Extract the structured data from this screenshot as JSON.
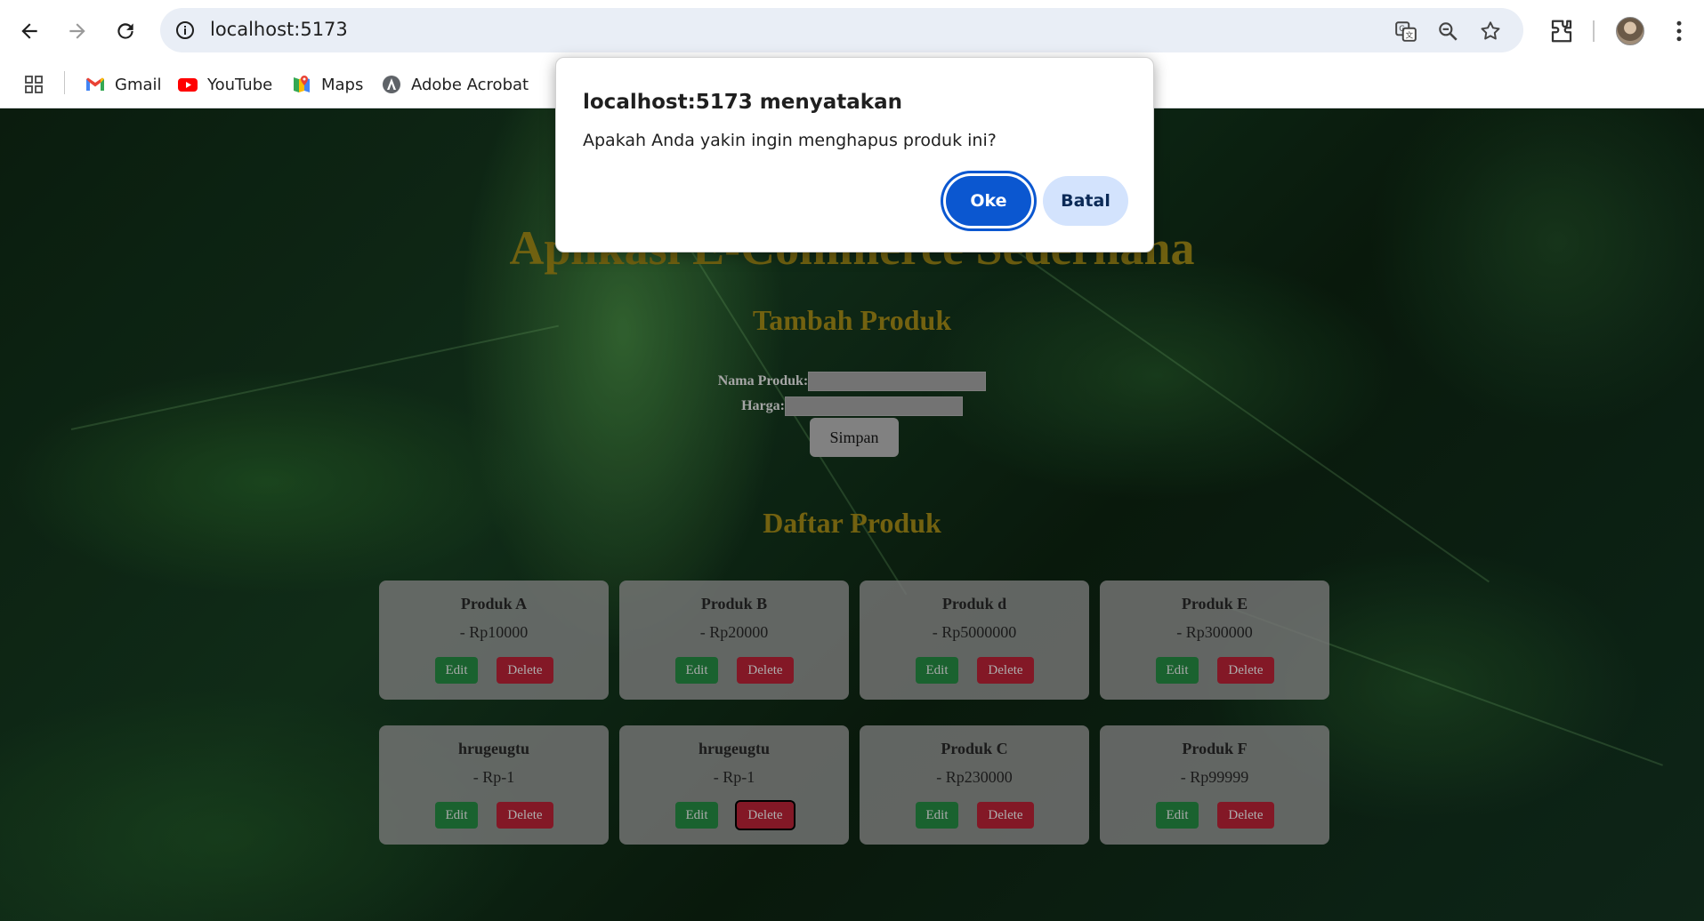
{
  "browser": {
    "url": "localhost:5173",
    "bookmarks": [
      {
        "label": "Gmail",
        "icon": "gmail-icon"
      },
      {
        "label": "YouTube",
        "icon": "youtube-icon"
      },
      {
        "label": "Maps",
        "icon": "maps-icon"
      },
      {
        "label": "Adobe Acrobat",
        "icon": "acrobat-icon"
      }
    ]
  },
  "page": {
    "title": "Aplikasi E-Commerce Sederhana",
    "add_section_title": "Tambah Produk",
    "name_label": "Nama Produk:",
    "price_label": "Harga:",
    "save_label": "Simpan",
    "list_title": "Daftar Produk",
    "edit_label": "Edit",
    "delete_label": "Delete",
    "products": [
      {
        "name": "Produk A",
        "price": "- Rp10000"
      },
      {
        "name": "Produk B",
        "price": "- Rp20000"
      },
      {
        "name": "Produk d",
        "price": "- Rp5000000"
      },
      {
        "name": "Produk E",
        "price": "- Rp300000"
      },
      {
        "name": "hrugeugtu",
        "price": "- Rp-1"
      },
      {
        "name": "hrugeugtu",
        "price": "- Rp-1"
      },
      {
        "name": "Produk C",
        "price": "- Rp230000"
      },
      {
        "name": "Produk F",
        "price": "- Rp99999"
      }
    ]
  },
  "dialog": {
    "title": "localhost:5173 menyatakan",
    "message": "Apakah Anda yakin ingin menghapus produk ini?",
    "ok_label": "Oke",
    "cancel_label": "Batal"
  },
  "colors": {
    "dialog_primary": "#0b57d0",
    "dialog_secondary": "#d3e3fd",
    "edit_button": "#1d6b34",
    "delete_button": "#8f1b2a",
    "heading": "#7a6a12"
  }
}
